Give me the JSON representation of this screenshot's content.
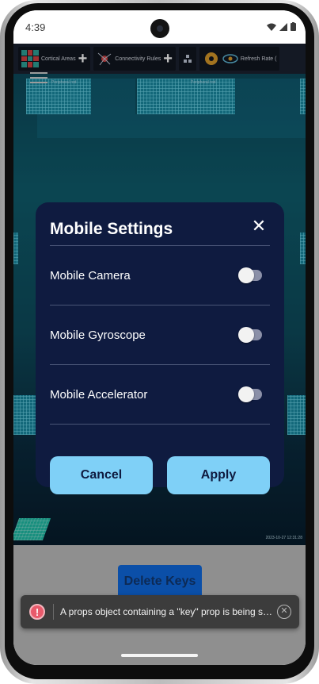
{
  "status_bar": {
    "time": "4:39",
    "icons": [
      "wifi-icon",
      "cell-signal-icon",
      "battery-icon"
    ]
  },
  "toolbar": {
    "cortical_areas_label": "Cortical Areas",
    "connectivity_rules_label": "Connectivity Rules",
    "refresh_rate_label": "Refresh Rate (",
    "plus": "+"
  },
  "canvas": {
    "panel_label_left": "Peripheral rod",
    "panel_label_right": "Peripheral rod",
    "timestamp": "2023-10-27 12:31:28"
  },
  "modal": {
    "title": "Mobile Settings",
    "close": "✕",
    "settings": [
      {
        "label": "Mobile Camera",
        "enabled": false
      },
      {
        "label": "Mobile Gyroscope",
        "enabled": false
      },
      {
        "label": "Mobile Accelerator",
        "enabled": false
      }
    ],
    "cancel_label": "Cancel",
    "apply_label": "Apply"
  },
  "background_actions": {
    "delete_keys_label": "Delete Keys"
  },
  "toast": {
    "icon": "!",
    "message": "A props object containing a \"key\" prop is being spread into JSX",
    "close": "✕"
  },
  "colors": {
    "modal_bg": "#0f1b40",
    "button_accent": "#7fd0f7",
    "toast_bg": "#3c3c3c",
    "error_icon": "#e85a6b"
  }
}
